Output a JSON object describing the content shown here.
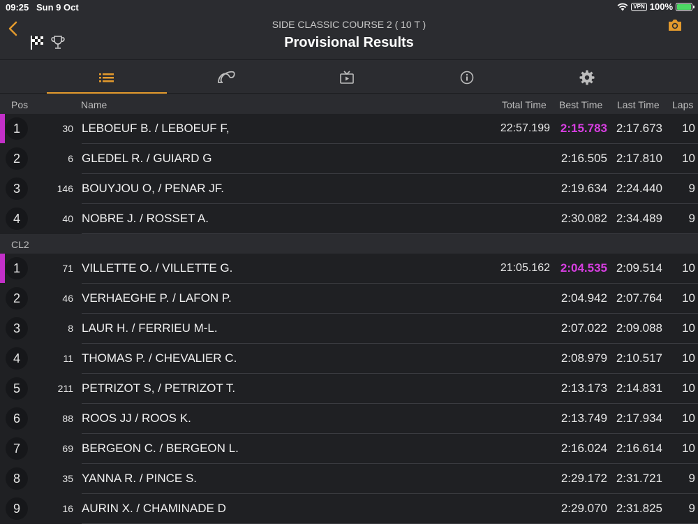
{
  "status": {
    "time": "09:25",
    "date": "Sun 9 Oct",
    "vpn": "VPN",
    "battery": "100%",
    "battery_level": 1.0
  },
  "header": {
    "subtitle": "SIDE CLASSIC COURSE 2 ( 10 T )",
    "title": "Provisional Results"
  },
  "tabs": [
    {
      "icon": "list-icon",
      "active": true
    },
    {
      "icon": "track-icon",
      "active": false
    },
    {
      "icon": "tv-icon",
      "active": false
    },
    {
      "icon": "info-icon",
      "active": false
    },
    {
      "icon": "gear-icon",
      "active": false
    }
  ],
  "columns": {
    "pos": "Pos",
    "name": "Name",
    "total": "Total Time",
    "best": "Best Time",
    "last": "Last Time",
    "laps": "Laps"
  },
  "colors": {
    "accent": "#e39a2d",
    "fastest": "#d63ee0",
    "leader_bar": "#c330c9"
  },
  "classes": [
    {
      "label": "",
      "rows": [
        {
          "pos": "1",
          "num": "30",
          "name": "LEBOEUF B. /  LEBOEUF F,",
          "total": "22:57.199",
          "best": "2:15.783",
          "last": "2:17.673",
          "laps": "10",
          "fastest": true,
          "leader": true
        },
        {
          "pos": "2",
          "num": "6",
          "name": "GLEDEL R. / GUIARD G",
          "total": "",
          "best": "2:16.505",
          "last": "2:17.810",
          "laps": "10",
          "fastest": false,
          "leader": false
        },
        {
          "pos": "3",
          "num": "146",
          "name": "BOUYJOU O, / PENAR JF.",
          "total": "",
          "best": "2:19.634",
          "last": "2:24.440",
          "laps": "9",
          "fastest": false,
          "leader": false
        },
        {
          "pos": "4",
          "num": "40",
          "name": "NOBRE J. / ROSSET A.",
          "total": "",
          "best": "2:30.082",
          "last": "2:34.489",
          "laps": "9",
          "fastest": false,
          "leader": false
        }
      ]
    },
    {
      "label": "CL2",
      "rows": [
        {
          "pos": "1",
          "num": "71",
          "name": "VILLETTE O. / VILLETTE G.",
          "total": "21:05.162",
          "best": "2:04.535",
          "last": "2:09.514",
          "laps": "10",
          "fastest": true,
          "leader": true
        },
        {
          "pos": "2",
          "num": "46",
          "name": "VERHAEGHE P. / LAFON P.",
          "total": "",
          "best": "2:04.942",
          "last": "2:07.764",
          "laps": "10",
          "fastest": false,
          "leader": false
        },
        {
          "pos": "3",
          "num": "8",
          "name": "LAUR H. / FERRIEU M-L.",
          "total": "",
          "best": "2:07.022",
          "last": "2:09.088",
          "laps": "10",
          "fastest": false,
          "leader": false
        },
        {
          "pos": "4",
          "num": "11",
          "name": "THOMAS P. / CHEVALIER C.",
          "total": "",
          "best": "2:08.979",
          "last": "2:10.517",
          "laps": "10",
          "fastest": false,
          "leader": false
        },
        {
          "pos": "5",
          "num": "211",
          "name": "PETRIZOT S, / PETRIZOT T.",
          "total": "",
          "best": "2:13.173",
          "last": "2:14.831",
          "laps": "10",
          "fastest": false,
          "leader": false
        },
        {
          "pos": "6",
          "num": "88",
          "name": "ROOS JJ / ROOS K.",
          "total": "",
          "best": "2:13.749",
          "last": "2:17.934",
          "laps": "10",
          "fastest": false,
          "leader": false
        },
        {
          "pos": "7",
          "num": "69",
          "name": "BERGEON C. / BERGEON L.",
          "total": "",
          "best": "2:16.024",
          "last": "2:16.614",
          "laps": "10",
          "fastest": false,
          "leader": false
        },
        {
          "pos": "8",
          "num": "35",
          "name": "YANNA R. / PINCE S.",
          "total": "",
          "best": "2:29.172",
          "last": "2:31.721",
          "laps": "9",
          "fastest": false,
          "leader": false
        },
        {
          "pos": "9",
          "num": "16",
          "name": "AURIN X. / CHAMINADE D",
          "total": "",
          "best": "2:29.070",
          "last": "2:31.825",
          "laps": "9",
          "fastest": false,
          "leader": false
        }
      ]
    }
  ]
}
